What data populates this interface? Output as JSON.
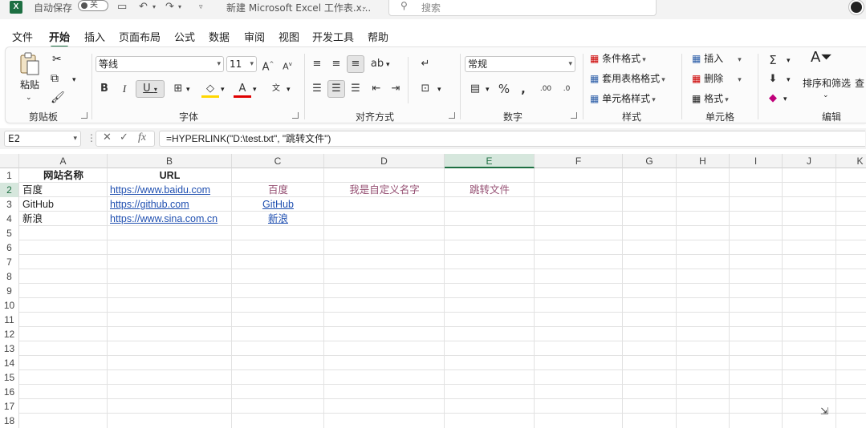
{
  "window": {
    "autosave_label": "自动保存",
    "autosave_state": "关",
    "doc_title": "新建 Microsoft Excel 工作表.x...",
    "search_placeholder": "搜索"
  },
  "menu_tabs": [
    "文件",
    "开始",
    "插入",
    "页面布局",
    "公式",
    "数据",
    "审阅",
    "视图",
    "开发工具",
    "帮助"
  ],
  "active_tab": "开始",
  "ribbon": {
    "clipboard": {
      "paste_label": "粘贴",
      "group_label": "剪贴板"
    },
    "font": {
      "font_name": "等线",
      "font_size": "11",
      "group_label": "字体"
    },
    "alignment": {
      "group_label": "对齐方式"
    },
    "number": {
      "format": "常规",
      "group_label": "数字"
    },
    "styles": {
      "conditional_format": "条件格式",
      "table_format": "套用表格格式",
      "cell_styles": "单元格样式",
      "group_label": "样式"
    },
    "cells": {
      "insert": "插入",
      "delete": "删除",
      "format": "格式",
      "group_label": "单元格"
    },
    "editing": {
      "sort_filter": "排序和筛选",
      "find_partial": "查",
      "group_label": "编辑"
    }
  },
  "formula_bar": {
    "name_box": "E2",
    "fx": "fx",
    "formula": "=HYPERLINK(\"D:\\test.txt\", \"跳转文件\")"
  },
  "sheet": {
    "columns": [
      "A",
      "B",
      "C",
      "D",
      "E",
      "F",
      "G",
      "H",
      "I",
      "J",
      "K"
    ],
    "selected_column": "E",
    "rows": [
      "1",
      "2",
      "3",
      "4",
      "5",
      "6",
      "7",
      "8",
      "9",
      "10",
      "11",
      "12",
      "13",
      "14",
      "15",
      "16",
      "17",
      "18"
    ],
    "selected_row": "2",
    "cells": {
      "A1": "网站名称",
      "B1": "URL",
      "A2": "百度",
      "B2": "https://www.baidu.com",
      "C2": "百度",
      "D2": "我是自定义名字",
      "E2": "跳转文件",
      "A3": "GitHub",
      "B3": "https://github.com",
      "C3": "GitHub",
      "A4": "新浪",
      "B4": "https://www.sina.com.cn",
      "C4": "新浪"
    }
  },
  "colors": {
    "accent": "#1d6f42",
    "link": "#1f4fb0",
    "visited_link": "#954f72"
  }
}
